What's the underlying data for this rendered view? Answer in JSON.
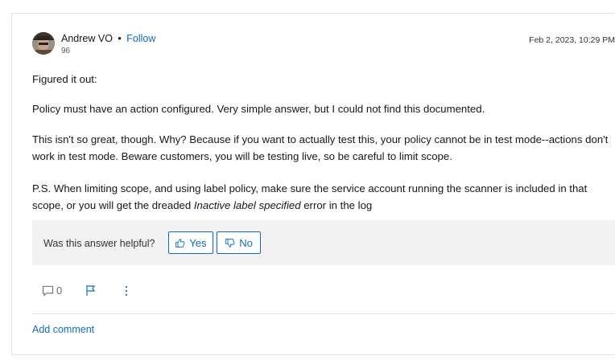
{
  "post": {
    "author": "Andrew VO",
    "separator": "•",
    "follow_label": "Follow",
    "reputation": "96",
    "date": "Feb 2, 2023, 10:29 PM",
    "paragraphs": {
      "p1": "Figured it out:",
      "p2": "Policy must have an action configured. Very simple answer, but I could not find this documented.",
      "p3": "This isn't so great, though. Why? Because if you want to actually test this, your policy cannot be in test mode--actions don't work in test mode. Beware customers, you will be testing live, so be careful to limit scope.",
      "p4_before": "P.S. When limiting scope, and using label policy, make sure the service account running the scanner is included in that scope, or you will get the dreaded ",
      "p4_italic": "Inactive label specified",
      "p4_after": " error in the log"
    }
  },
  "helpful": {
    "question": "Was this answer helpful?",
    "yes_label": "Yes",
    "no_label": "No"
  },
  "actions": {
    "comment_count": "0"
  },
  "add_comment_label": "Add comment",
  "icons": {
    "comment": "comment-icon",
    "flag": "flag-icon",
    "more": "more-options-icon",
    "thumbs_up": "thumbs-up-icon",
    "thumbs_down": "thumbs-down-icon"
  },
  "colors": {
    "link": "#0f6cbd",
    "helpful_bg": "#f2f2f2"
  }
}
